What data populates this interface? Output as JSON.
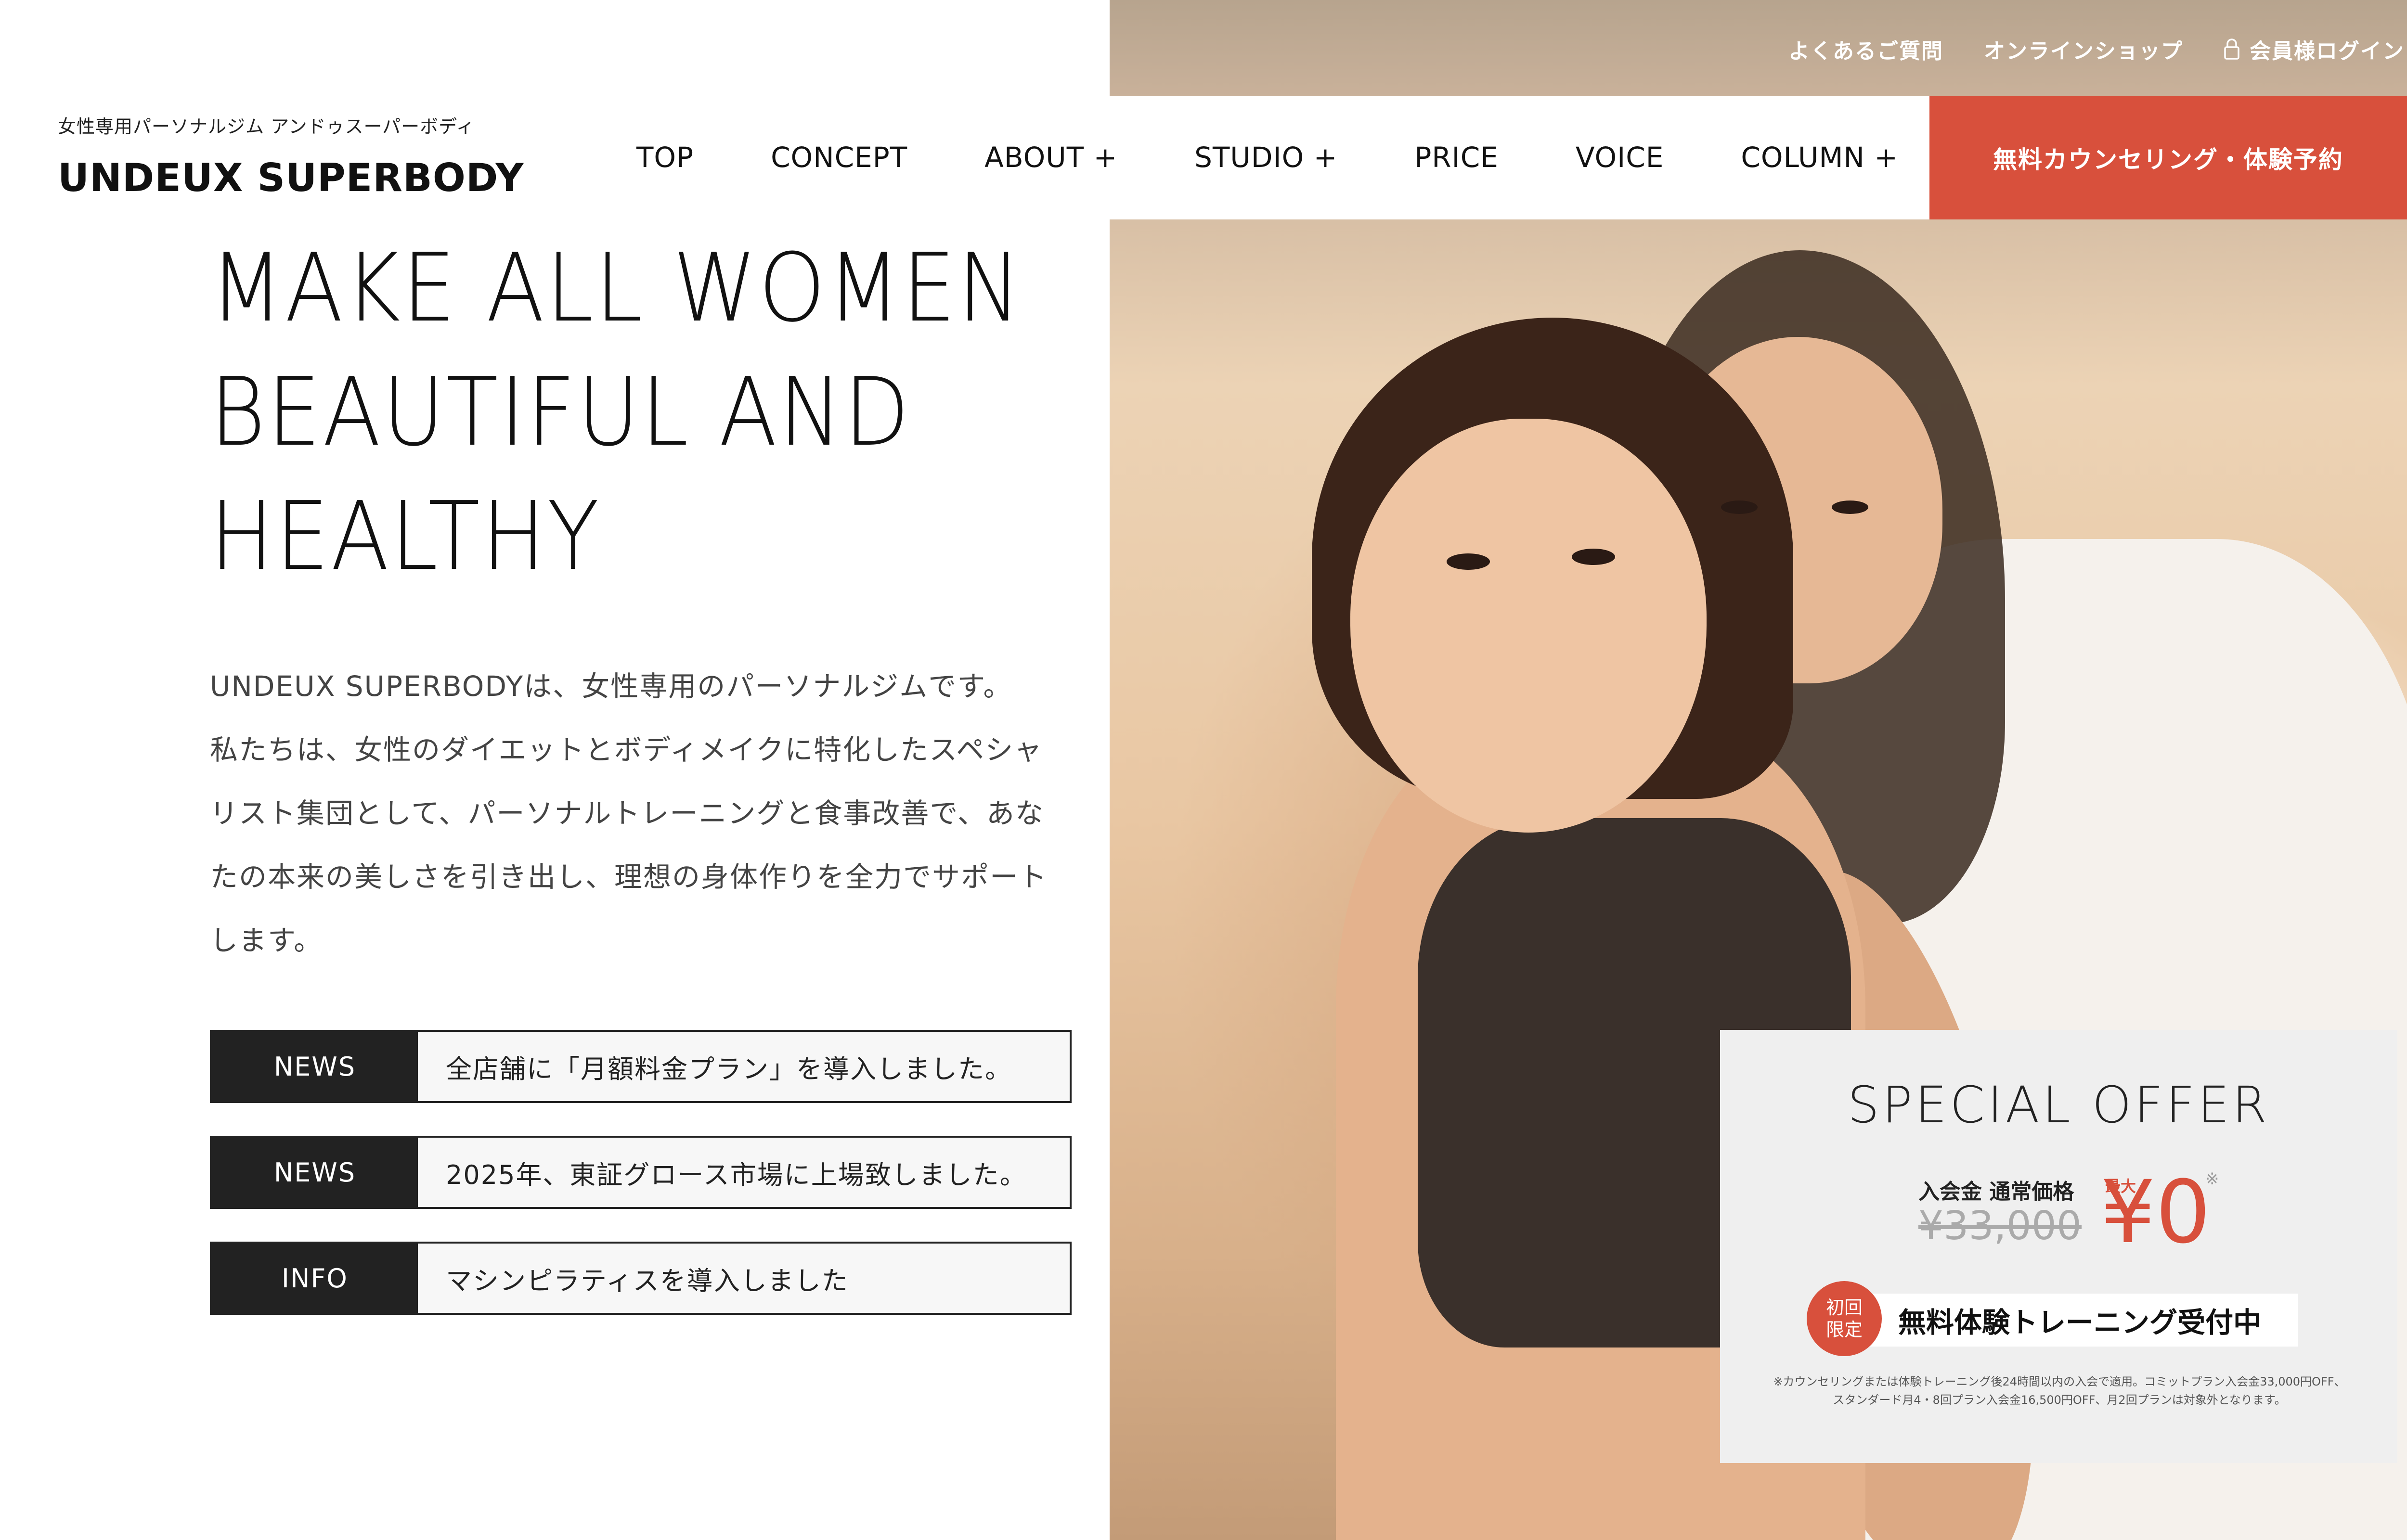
{
  "utility_nav": {
    "faq": "よくあるご質問",
    "shop": "オンラインショップ",
    "login": "会員様ログイン"
  },
  "logo": {
    "subtitle": "女性専用パーソナルジム アンドゥスーパーボディ",
    "name": "UNDEUX SUPERBODY"
  },
  "nav": {
    "items": [
      "TOP",
      "CONCEPT",
      "ABOUT +",
      "STUDIO +",
      "PRICE",
      "VOICE",
      "COLUMN +"
    ],
    "cta": "無料カウンセリング・体験予約"
  },
  "hero": {
    "heading_lines": [
      "MAKE ALL WOMEN",
      "BEAUTIFUL AND",
      "HEALTHY"
    ],
    "body_lines": [
      "UNDEUX SUPERBODYは、女性専用のパーソナルジムです。",
      "私たちは、女性のダイエットとボディメイクに特化したスペシャ",
      "リスト集団として、パーソナルトレーニングと食事改善で、あな",
      "たの本来の美しさを引き出し、理想の身体作りを全力でサポート",
      "します。"
    ]
  },
  "news": [
    {
      "tag": "NEWS",
      "text": "全店舗に「月額料金プラン」を導入しました。"
    },
    {
      "tag": "NEWS",
      "text": "2025年、東証グロース市場に上場致しました。"
    },
    {
      "tag": "INFO",
      "text": "マシンピラティスを導入しました"
    }
  ],
  "offer": {
    "title": "SPECIAL OFFER",
    "fee_label": "入会金 通常価格",
    "regular_price": "¥33,000",
    "max_label": "最大",
    "price": "¥0",
    "note_mark": "※",
    "badge": "初回 限定",
    "badge_line1": "初回",
    "badge_line2": "限定",
    "trial": "無料体験トレーニング受付中",
    "footnote": "※カウンセリングまたは体験トレーニング後24時間以内の入会で適用。コミットプラン入会金33,000円OFF、スタンダード月4・8回プラン入会金16,500円OFF、月2回プランは対象外となります。"
  },
  "colors": {
    "accent": "#d8503c",
    "dark": "#222222",
    "offer_bg": "#efefef"
  },
  "icons": {
    "login": "lock-icon"
  }
}
